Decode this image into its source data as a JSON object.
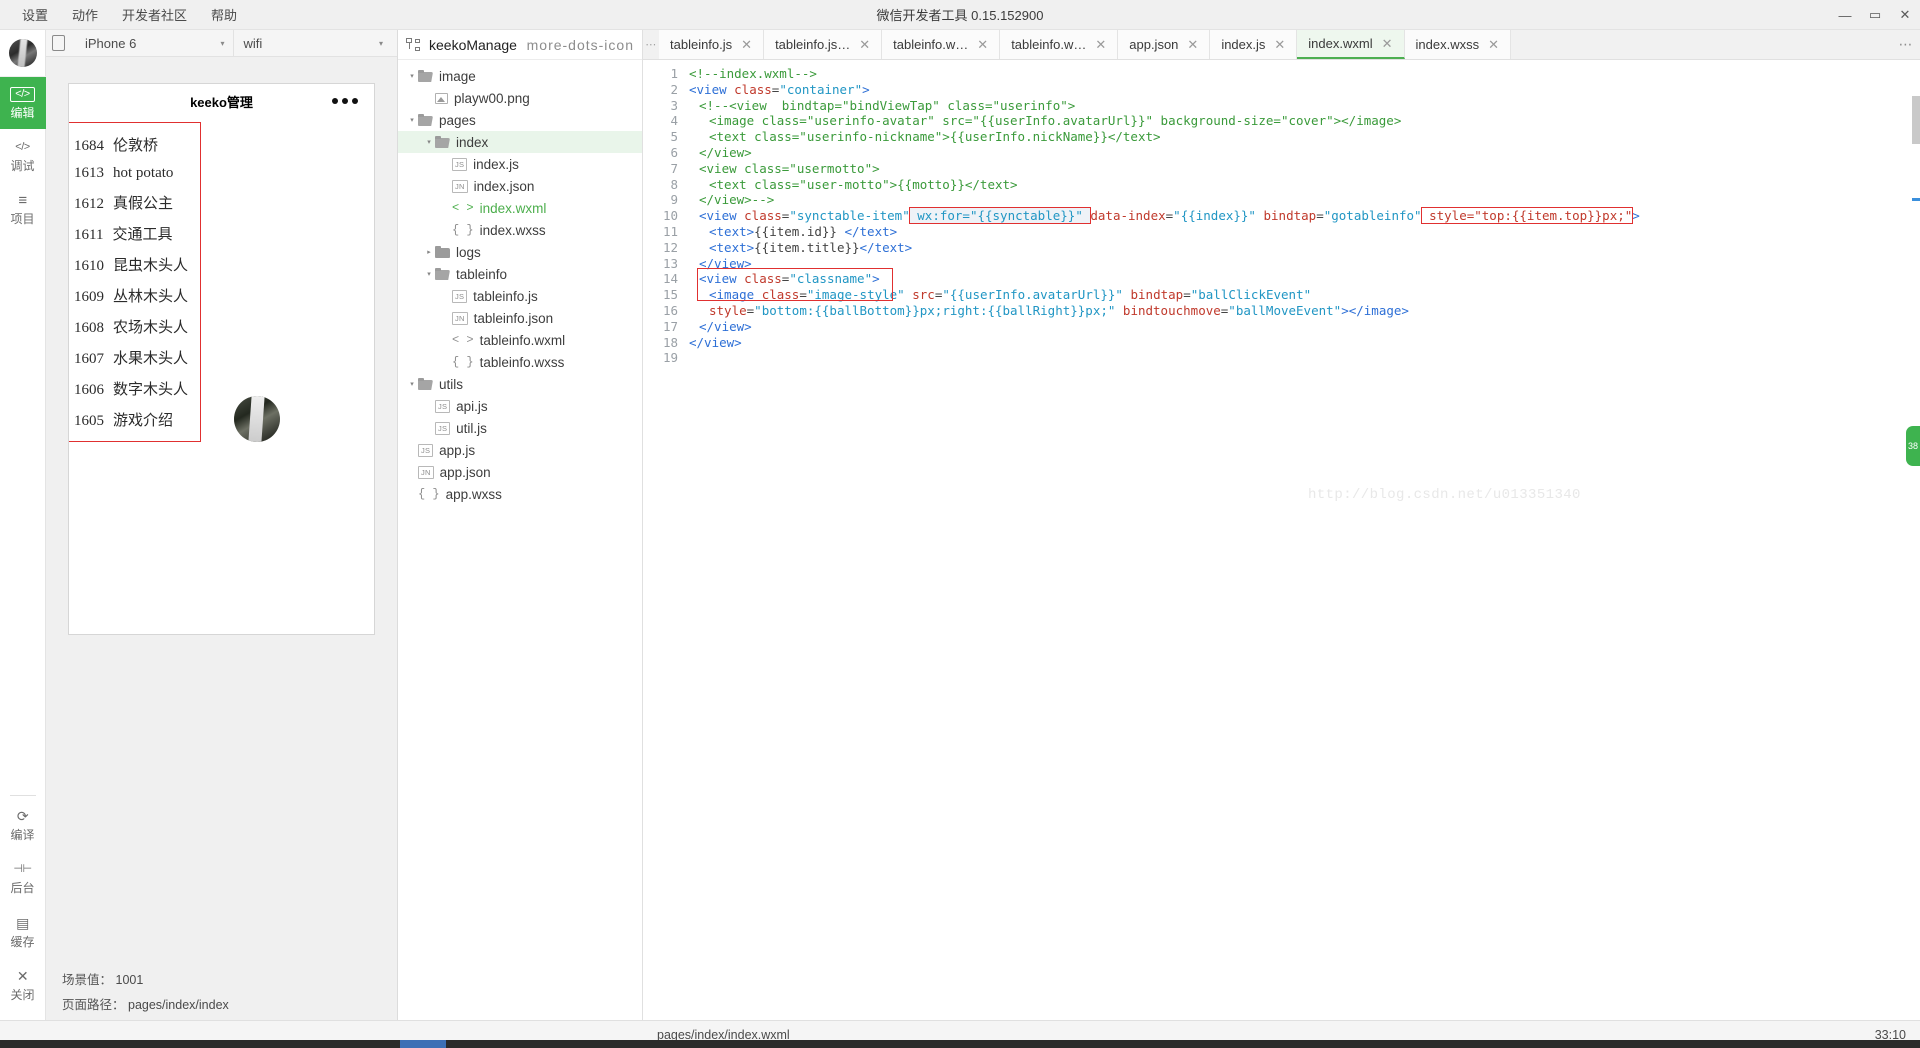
{
  "window": {
    "title": "微信开发者工具 0.15.152900",
    "minimize": "—",
    "maximize": "▭",
    "close": "✕"
  },
  "menubar": {
    "items": [
      {
        "label": "设置"
      },
      {
        "label": "动作"
      },
      {
        "label": "开发者社区"
      },
      {
        "label": "帮助"
      }
    ]
  },
  "rail": {
    "top_items": [
      {
        "icon": "code-brackets-icon",
        "glyph": "</>",
        "label": "编辑",
        "active": true
      },
      {
        "icon": "debug-icon",
        "glyph": "</>",
        "label": "调试",
        "active": false
      },
      {
        "icon": "project-lines-icon",
        "glyph": "≡",
        "label": "项目",
        "active": false
      }
    ],
    "bottom_items": [
      {
        "icon": "compile-refresh-icon",
        "glyph": "⟳",
        "label": "编译"
      },
      {
        "icon": "background-icon",
        "glyph": "⊣⊢",
        "label": "后台"
      },
      {
        "icon": "cache-layers-icon",
        "glyph": "▤",
        "label": "缓存"
      },
      {
        "icon": "close-x-icon",
        "glyph": "✕",
        "label": "关闭"
      }
    ]
  },
  "simulator": {
    "device": "iPhone 6",
    "device_caret": "▾",
    "network": "wifi",
    "network_caret": "▾",
    "rotate_icon": "rotate-device-icon",
    "phone": {
      "nav_title": "keeko管理",
      "more_icon": "more-dots-icon",
      "list": [
        {
          "id": "1684",
          "title": "伦敦桥"
        },
        {
          "id": "1613",
          "title": "hot potato"
        },
        {
          "id": "1612",
          "title": "真假公主"
        },
        {
          "id": "1611",
          "title": "交通工具"
        },
        {
          "id": "1610",
          "title": "昆虫木头人"
        },
        {
          "id": "1609",
          "title": "丛林木头人"
        },
        {
          "id": "1608",
          "title": "农场木头人"
        },
        {
          "id": "1607",
          "title": "水果木头人"
        },
        {
          "id": "1606",
          "title": "数字木头人"
        },
        {
          "id": "1605",
          "title": "游戏介绍"
        }
      ]
    },
    "footer": {
      "scene_label": "场景值：",
      "scene_value": "1001",
      "path_label": "页面路径：",
      "path_value": "pages/index/index"
    }
  },
  "filetree": {
    "project_icon": "project-structure-icon",
    "project_name": "keekoManage",
    "more_icon": "more-dots-icon",
    "arrow_open": "▾",
    "arrow_closed": "▸",
    "nodes": [
      {
        "name": "image",
        "kind": "folder",
        "state": "open",
        "depth": 0,
        "icon": "folder-icon"
      },
      {
        "name": "playw00.png",
        "kind": "image",
        "state": "",
        "depth": 1,
        "icon": "image-file-icon"
      },
      {
        "name": "pages",
        "kind": "folder",
        "state": "open",
        "depth": 0,
        "icon": "folder-icon"
      },
      {
        "name": "index",
        "kind": "folder",
        "state": "open",
        "depth": 1,
        "icon": "folder-icon",
        "selected": true
      },
      {
        "name": "index.js",
        "kind": "js",
        "badge": "JS",
        "depth": 2,
        "icon": "js-file-icon"
      },
      {
        "name": "index.json",
        "kind": "json",
        "badge": "JN",
        "depth": 2,
        "icon": "json-file-icon"
      },
      {
        "name": "index.wxml",
        "kind": "wxml",
        "sym": "< >",
        "depth": 2,
        "icon": "wxml-file-icon",
        "green": true
      },
      {
        "name": "index.wxss",
        "kind": "wxss",
        "sym": "{ }",
        "depth": 2,
        "icon": "wxss-file-icon"
      },
      {
        "name": "logs",
        "kind": "folder",
        "state": "closed",
        "depth": 1,
        "icon": "folder-icon"
      },
      {
        "name": "tableinfo",
        "kind": "folder",
        "state": "open",
        "depth": 1,
        "icon": "folder-icon"
      },
      {
        "name": "tableinfo.js",
        "kind": "js",
        "badge": "JS",
        "depth": 2,
        "icon": "js-file-icon"
      },
      {
        "name": "tableinfo.json",
        "kind": "json",
        "badge": "JN",
        "depth": 2,
        "icon": "json-file-icon"
      },
      {
        "name": "tableinfo.wxml",
        "kind": "wxml",
        "sym": "< >",
        "depth": 2,
        "icon": "wxml-file-icon"
      },
      {
        "name": "tableinfo.wxss",
        "kind": "wxss",
        "sym": "{ }",
        "depth": 2,
        "icon": "wxss-file-icon"
      },
      {
        "name": "utils",
        "kind": "folder",
        "state": "open",
        "depth": 0,
        "icon": "folder-icon"
      },
      {
        "name": "api.js",
        "kind": "js",
        "badge": "JS",
        "depth": 1,
        "icon": "js-file-icon"
      },
      {
        "name": "util.js",
        "kind": "js",
        "badge": "JS",
        "depth": 1,
        "icon": "js-file-icon"
      },
      {
        "name": "app.js",
        "kind": "js",
        "badge": "JS",
        "depth": 0,
        "icon": "js-file-icon"
      },
      {
        "name": "app.json",
        "kind": "json",
        "badge": "JN",
        "depth": 0,
        "icon": "json-file-icon"
      },
      {
        "name": "app.wxss",
        "kind": "wxss",
        "sym": "{ }",
        "depth": 0,
        "icon": "wxss-file-icon"
      }
    ]
  },
  "editor": {
    "tab_prev_icon": "tab-overflow-icon",
    "tab_more_icon": "more-dots-icon",
    "close_icon": "✕",
    "tabs": [
      {
        "label": "tableinfo.js",
        "active": false
      },
      {
        "label": "tableinfo.js…",
        "active": false
      },
      {
        "label": "tableinfo.w…",
        "active": false
      },
      {
        "label": "tableinfo.w…",
        "active": false
      },
      {
        "label": "app.json",
        "active": false
      },
      {
        "label": "index.js",
        "active": false
      },
      {
        "label": "index.wxml",
        "active": true
      },
      {
        "label": "index.wxss",
        "active": false
      }
    ],
    "watermark": "http://blog.csdn.net/u013351340",
    "lines": [
      {
        "n": 1,
        "parts": [
          {
            "t": "cmt",
            "s": "<!--index.wxml-->"
          }
        ],
        "indent": 0
      },
      {
        "n": 2,
        "parts": [
          {
            "t": "tag",
            "s": "<view "
          },
          {
            "t": "attr",
            "s": "class"
          },
          {
            "t": "punc",
            "s": "="
          },
          {
            "t": "str",
            "s": "\"container\""
          },
          {
            "t": "tag",
            "s": ">"
          }
        ],
        "indent": 0
      },
      {
        "n": 3,
        "parts": [
          {
            "t": "cmt",
            "s": "<!--<view  bindtap=\"bindViewTap\" class=\"userinfo\">"
          }
        ],
        "indent": 1
      },
      {
        "n": 4,
        "parts": [
          {
            "t": "cmt",
            "s": "<image class=\"userinfo-avatar\" src=\"{{userInfo.avatarUrl}}\" background-size=\"cover\"></image>"
          }
        ],
        "indent": 2
      },
      {
        "n": 5,
        "parts": [
          {
            "t": "cmt",
            "s": "<text class=\"userinfo-nickname\">{{userInfo.nickName}}</text>"
          }
        ],
        "indent": 2
      },
      {
        "n": 6,
        "parts": [
          {
            "t": "cmt",
            "s": "</view>"
          }
        ],
        "indent": 1
      },
      {
        "n": 7,
        "parts": [
          {
            "t": "cmt",
            "s": "<view class=\"usermotto\">"
          }
        ],
        "indent": 1
      },
      {
        "n": 8,
        "parts": [
          {
            "t": "cmt",
            "s": "<text class=\"user-motto\">{{motto}}</text>"
          }
        ],
        "indent": 2
      },
      {
        "n": 9,
        "parts": [
          {
            "t": "cmt",
            "s": "</view>-->"
          }
        ],
        "indent": 1
      },
      {
        "n": 10,
        "parts": [
          {
            "t": "tag",
            "s": "<view "
          },
          {
            "t": "attr",
            "s": "class"
          },
          {
            "t": "punc",
            "s": "="
          },
          {
            "t": "str",
            "s": "\"synctable-item\""
          },
          {
            "t": "box1",
            "s": " wx:for=\"{{synctable}}\" "
          },
          {
            "t": "attr",
            "s": "data-index"
          },
          {
            "t": "punc",
            "s": "="
          },
          {
            "t": "str",
            "s": "\"{{index}}\""
          },
          {
            "t": "attr",
            "s": " bindtap"
          },
          {
            "t": "punc",
            "s": "="
          },
          {
            "t": "str",
            "s": "\"gotableinfo\""
          },
          {
            "t": "box2",
            "s": " style=\"top:{{item.top}}px;\""
          },
          {
            "t": "tag",
            "s": ">"
          }
        ],
        "indent": 1
      },
      {
        "n": 11,
        "parts": [
          {
            "t": "tag",
            "s": "<text>"
          },
          {
            "t": "punc",
            "s": "{{item.id}} "
          },
          {
            "t": "tag",
            "s": "</text>"
          }
        ],
        "indent": 2
      },
      {
        "n": 12,
        "parts": [
          {
            "t": "tag",
            "s": "<text>"
          },
          {
            "t": "punc",
            "s": "{{item.title}}"
          },
          {
            "t": "tag",
            "s": "</text>"
          }
        ],
        "indent": 2
      },
      {
        "n": 13,
        "parts": [
          {
            "t": "tag",
            "s": "</view>"
          }
        ],
        "indent": 1
      },
      {
        "n": 14,
        "parts": [
          {
            "t": "tag",
            "s": "<view "
          },
          {
            "t": "attr",
            "s": "class"
          },
          {
            "t": "punc",
            "s": "="
          },
          {
            "t": "str",
            "s": "\"classname\""
          },
          {
            "t": "tag",
            "s": ">"
          }
        ],
        "indent": 1
      },
      {
        "n": 15,
        "parts": [
          {
            "t": "tag",
            "s": "<image "
          },
          {
            "t": "attr",
            "s": "class"
          },
          {
            "t": "punc",
            "s": "="
          },
          {
            "t": "str",
            "s": "\"image-style\""
          },
          {
            "t": "attr",
            "s": " src"
          },
          {
            "t": "punc",
            "s": "="
          },
          {
            "t": "str",
            "s": "\"{{userInfo.avatarUrl}}\""
          },
          {
            "t": "attr",
            "s": " bindtap"
          },
          {
            "t": "punc",
            "s": "="
          },
          {
            "t": "str",
            "s": "\"ballClickEvent\""
          }
        ],
        "indent": 2
      },
      {
        "n": 16,
        "parts": [
          {
            "t": "attr",
            "s": "style"
          },
          {
            "t": "punc",
            "s": "="
          },
          {
            "t": "str",
            "s": "\"bottom:{{ballBottom}}px;right:{{ballRight}}px;\""
          },
          {
            "t": "attr",
            "s": " bindtouchmove"
          },
          {
            "t": "punc",
            "s": "="
          },
          {
            "t": "str",
            "s": "\"ballMoveEvent\""
          },
          {
            "t": "tag",
            "s": "></image>"
          }
        ],
        "indent": 2
      },
      {
        "n": 17,
        "parts": [
          {
            "t": "tag",
            "s": "</view>"
          }
        ],
        "indent": 1
      },
      {
        "n": 18,
        "parts": [
          {
            "t": "tag",
            "s": "</view>"
          }
        ],
        "indent": 0
      },
      {
        "n": 19,
        "parts": [],
        "indent": 0
      }
    ]
  },
  "statusbar": {
    "file_path": "pages/index/index.wxml",
    "cursor_position": "33:10"
  },
  "sidetab": {
    "label": "38"
  },
  "colors": {
    "accent_green": "#3eb34f",
    "highlight_red": "#e03030",
    "tab_active_bg": "#eef7ee",
    "tree_selected_bg": "#e9f5ea"
  }
}
